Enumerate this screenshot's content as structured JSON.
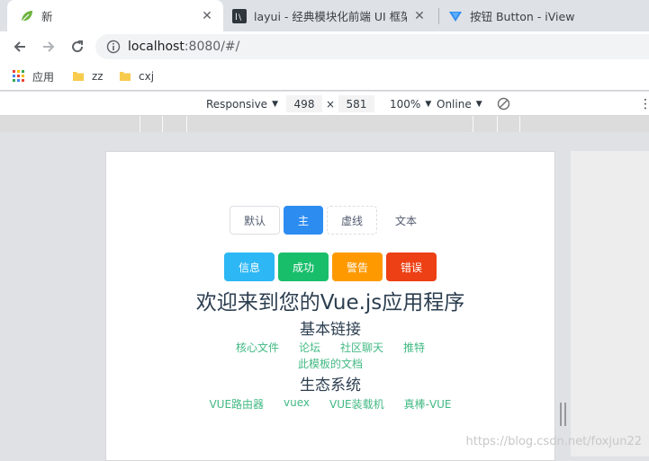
{
  "tabs": [
    {
      "title": "新",
      "icon": "spring-leaf-icon",
      "active": true
    },
    {
      "title": "layui - 经典模块化前端 UI 框架",
      "icon": "layui-icon",
      "active": false
    },
    {
      "title": "按钮 Button - iView",
      "icon": "iview-icon",
      "active": false
    }
  ],
  "address_bar": {
    "host": "localhost",
    "rest": ":8080/#/"
  },
  "bookmarks": [
    {
      "label": "应用",
      "icon": "apps-grid-icon"
    },
    {
      "label": "zz",
      "icon": "folder-icon"
    },
    {
      "label": "cxj",
      "icon": "folder-icon"
    }
  ],
  "device_toolbar": {
    "mode": "Responsive",
    "width": "498",
    "times": "×",
    "height": "581",
    "zoom": "100%",
    "network": "Online"
  },
  "page": {
    "buttons_row1": [
      {
        "label": "默认",
        "style": "default"
      },
      {
        "label": "主",
        "style": "primary"
      },
      {
        "label": "虚线",
        "style": "dashed"
      },
      {
        "label": "文本",
        "style": "text"
      }
    ],
    "buttons_row2": [
      {
        "label": "信息",
        "style": "info"
      },
      {
        "label": "成功",
        "style": "success"
      },
      {
        "label": "警告",
        "style": "warning"
      },
      {
        "label": "错误",
        "style": "error"
      }
    ],
    "title": "欢迎来到您的Vue.js应用程序",
    "section_basic": "基本链接",
    "basic_links": [
      "核心文件",
      "论坛",
      "社区聊天",
      "推特"
    ],
    "basic_links_2": [
      "此模板的文档"
    ],
    "section_ecosystem": "生态系统",
    "ecosystem_links": [
      "VUE路由器",
      "vuex",
      "VUE装载机",
      "真棒-VUE"
    ]
  },
  "watermark": "https://blog.csdn.net/foxjun22",
  "colors": {
    "primary": "#2d8cf0",
    "info": "#2db7f5",
    "success": "#19be6b",
    "warning": "#ff9900",
    "error": "#ed4014",
    "link": "#42b983",
    "heading": "#2c3e50"
  }
}
